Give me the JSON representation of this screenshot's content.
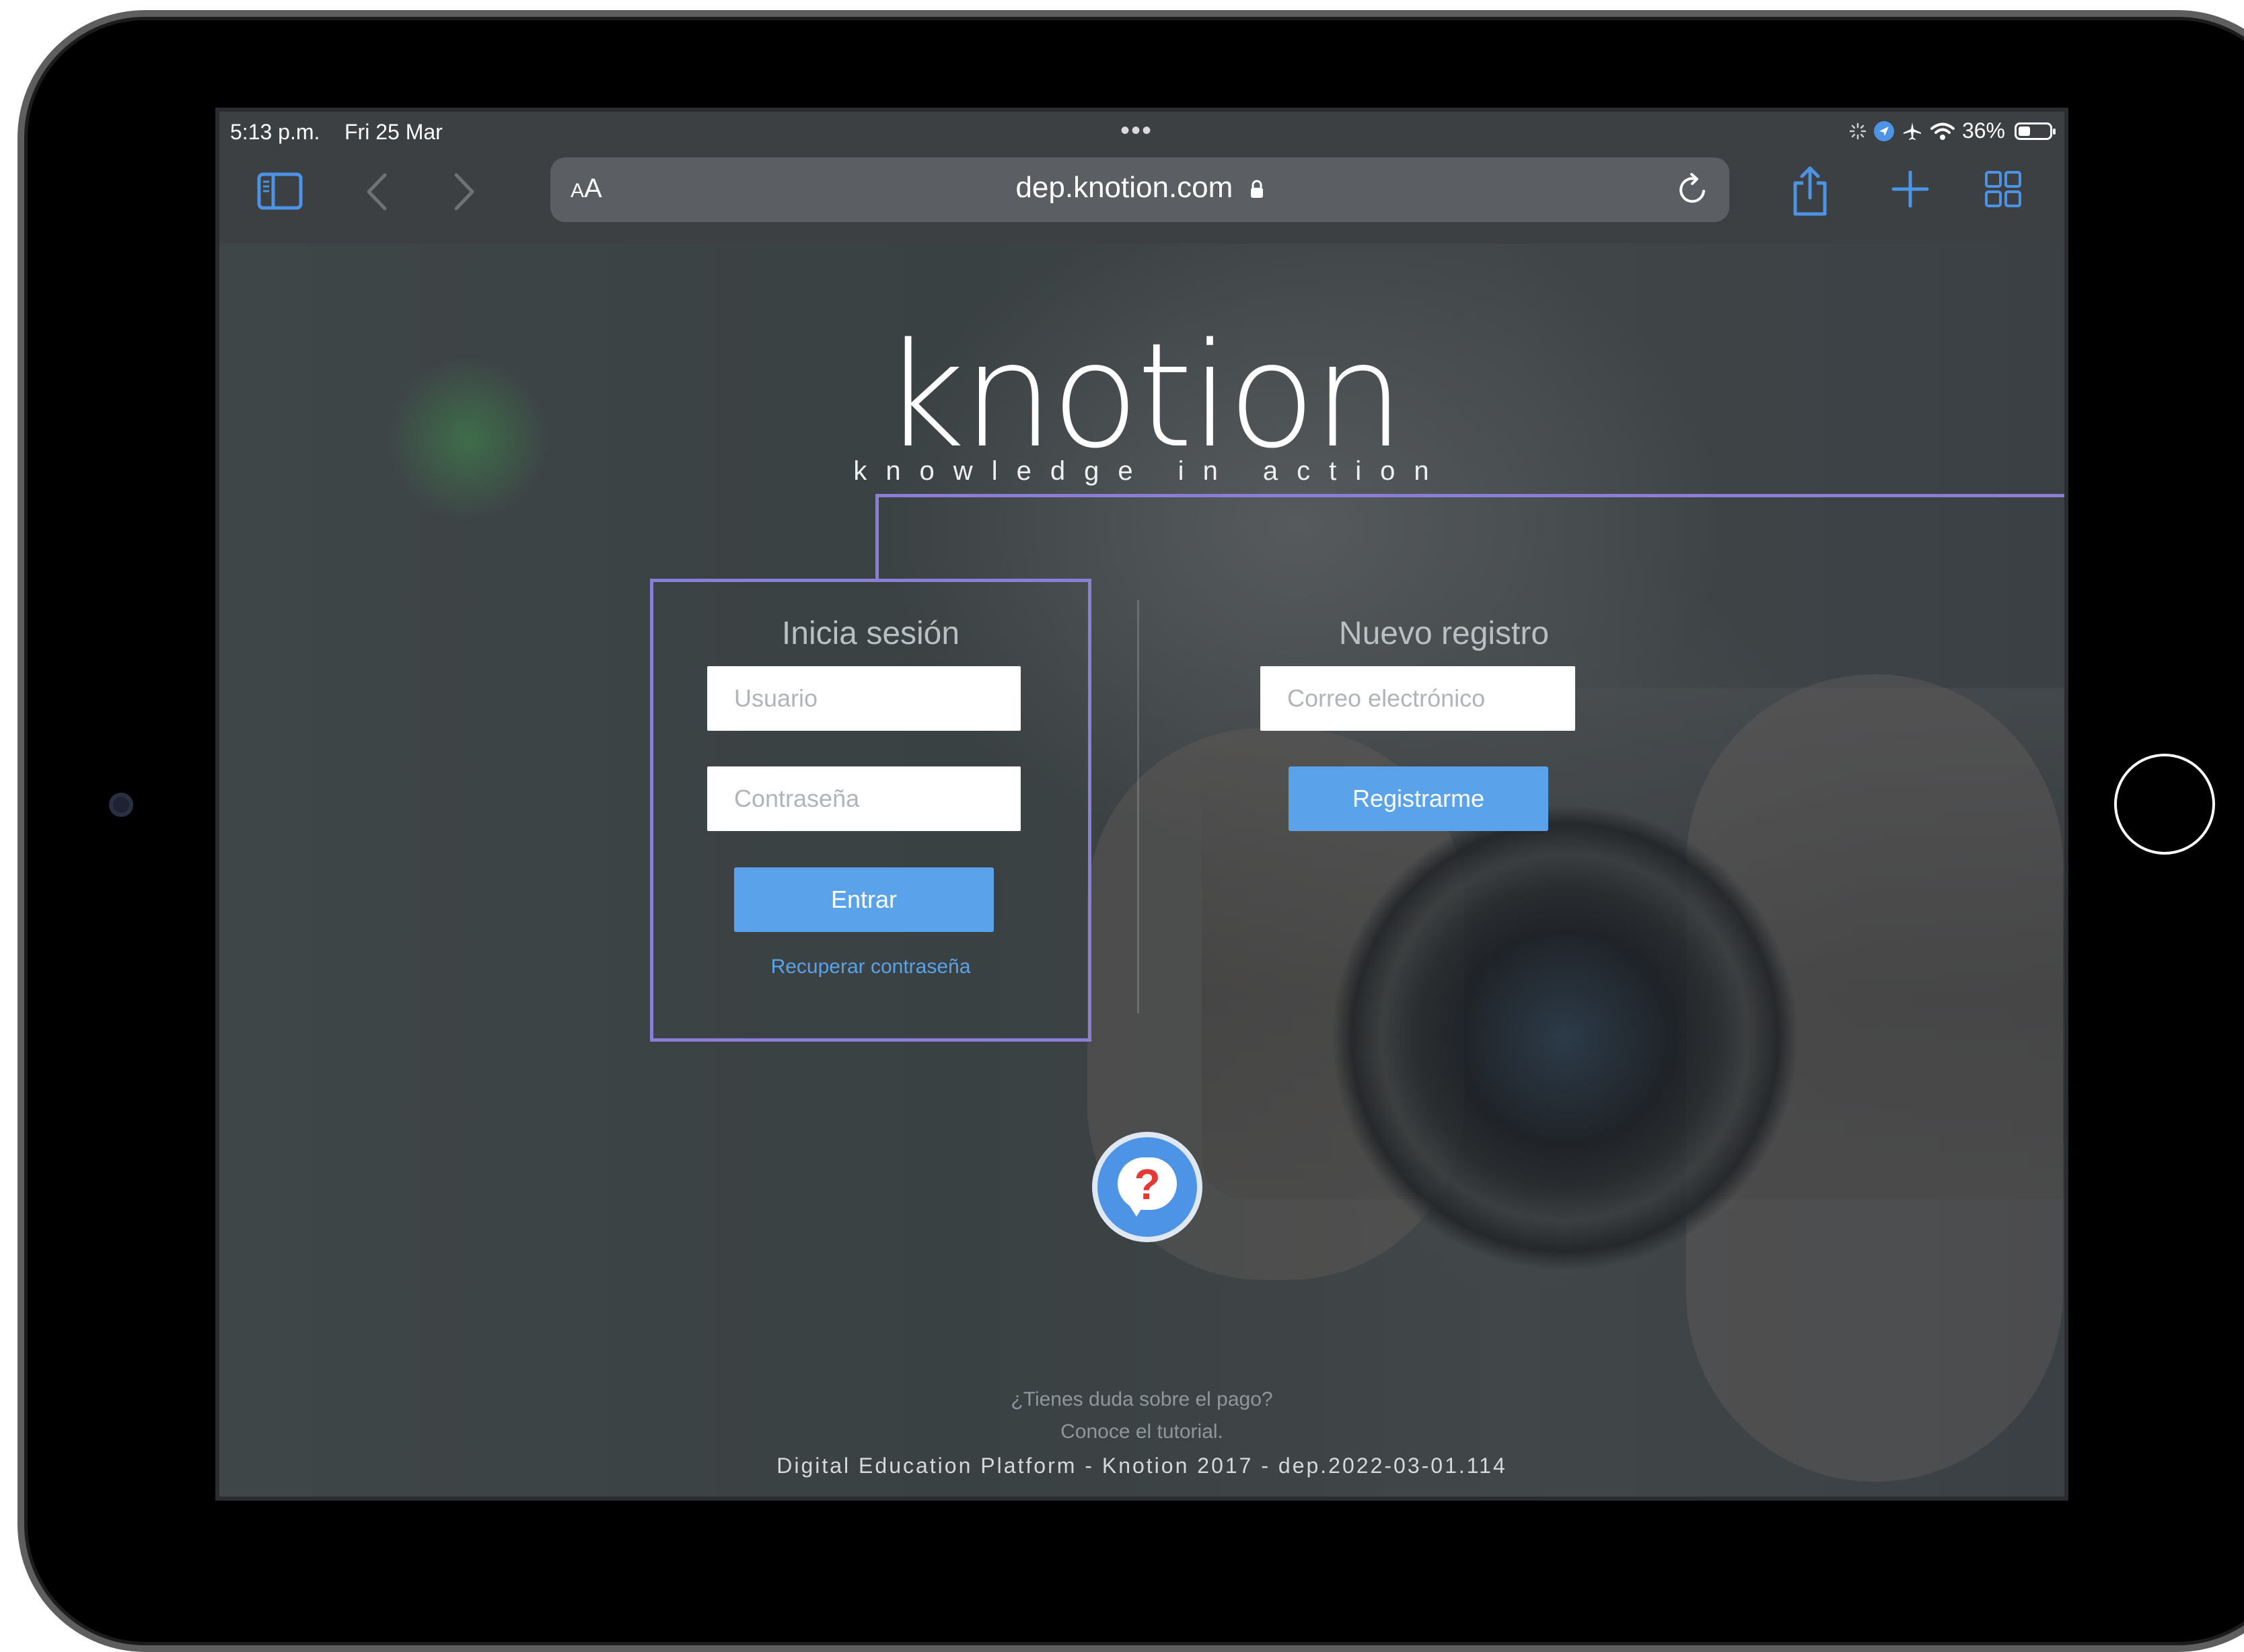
{
  "status_bar": {
    "time": "5:13 p.m.",
    "date": "Fri 25 Mar",
    "multitask_dots": "•••",
    "battery": "36%"
  },
  "browser": {
    "text_size_small": "A",
    "text_size_large": "A",
    "url": "dep.knotion.com",
    "accent_color": "#4d93e6"
  },
  "logo": {
    "wordmark": "knotion",
    "tagline": "knowledge in action"
  },
  "login": {
    "title": "Inicia sesión",
    "username_placeholder": "Usuario",
    "password_placeholder": "Contraseña",
    "submit_label": "Entrar",
    "recover_link": "Recuperar contraseña"
  },
  "register": {
    "title": "Nuevo registro",
    "email_placeholder": "Correo electrónico",
    "submit_label": "Registrarme"
  },
  "help": {
    "icon_symbol": "?",
    "question_line1": "¿Tienes duda sobre el pago?",
    "question_line2": "Conoce el tutorial."
  },
  "footer": {
    "text": "Digital Education Platform - Knotion 2017 - dep.2022-03-01.114"
  },
  "colors": {
    "button_blue": "#5aa2ea",
    "annotation": "#8a7fd4",
    "help_question_mark": "#e53935"
  }
}
